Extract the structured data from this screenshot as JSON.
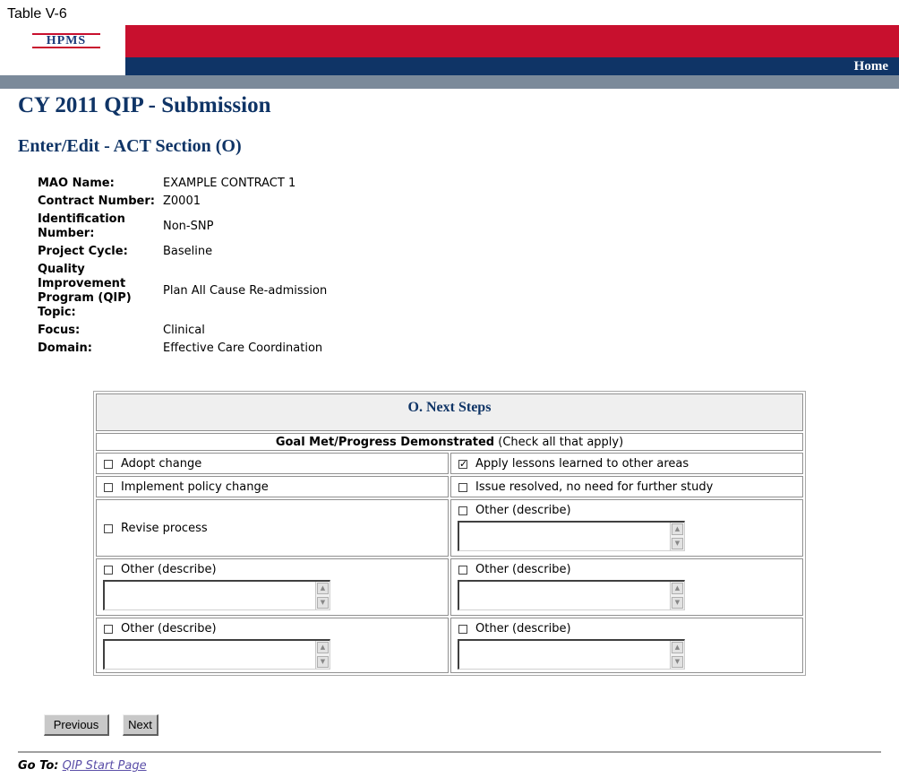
{
  "table_label": "Table V-6",
  "header": {
    "logo_text": "HPMS",
    "home_link": "Home"
  },
  "page_title": "CY 2011 QIP - Submission",
  "section_title": "Enter/Edit - ACT Section (O)",
  "info": {
    "mao_name_label": "MAO Name:",
    "mao_name_value": "EXAMPLE CONTRACT 1",
    "contract_number_label": "Contract Number:",
    "contract_number_value": "Z0001",
    "identification_number_label": "Identification Number:",
    "identification_number_value": "Non-SNP",
    "project_cycle_label": "Project Cycle:",
    "project_cycle_value": "Baseline",
    "qip_topic_label": "Quality Improvement Program (QIP) Topic:",
    "qip_topic_value": "Plan All Cause Re-admission",
    "focus_label": "Focus:",
    "focus_value": "Clinical",
    "domain_label": "Domain:",
    "domain_value": "Effective Care Coordination"
  },
  "next_steps": {
    "heading": "O. Next Steps",
    "goal_bold": "Goal Met/Progress Demonstrated",
    "goal_note": "(Check all that apply)",
    "options": {
      "adopt_change": {
        "label": "Adopt change",
        "checked": false
      },
      "apply_lessons": {
        "label": "Apply lessons learned to other areas",
        "checked": true
      },
      "implement_policy": {
        "label": "Implement policy change",
        "checked": false
      },
      "issue_resolved": {
        "label": "Issue resolved, no need for further study",
        "checked": false
      },
      "revise_process": {
        "label": "Revise process",
        "checked": false
      },
      "other_1": {
        "label": "Other (describe)",
        "checked": false,
        "value": ""
      },
      "other_2": {
        "label": "Other (describe)",
        "checked": false,
        "value": ""
      },
      "other_3": {
        "label": "Other (describe)",
        "checked": false,
        "value": ""
      },
      "other_4": {
        "label": "Other (describe)",
        "checked": false,
        "value": ""
      },
      "other_5": {
        "label": "Other (describe)",
        "checked": false,
        "value": ""
      }
    }
  },
  "buttons": {
    "previous": "Previous",
    "next": "Next"
  },
  "footer": {
    "goto_label": "Go To:",
    "goto_link": "QIP Start Page"
  }
}
